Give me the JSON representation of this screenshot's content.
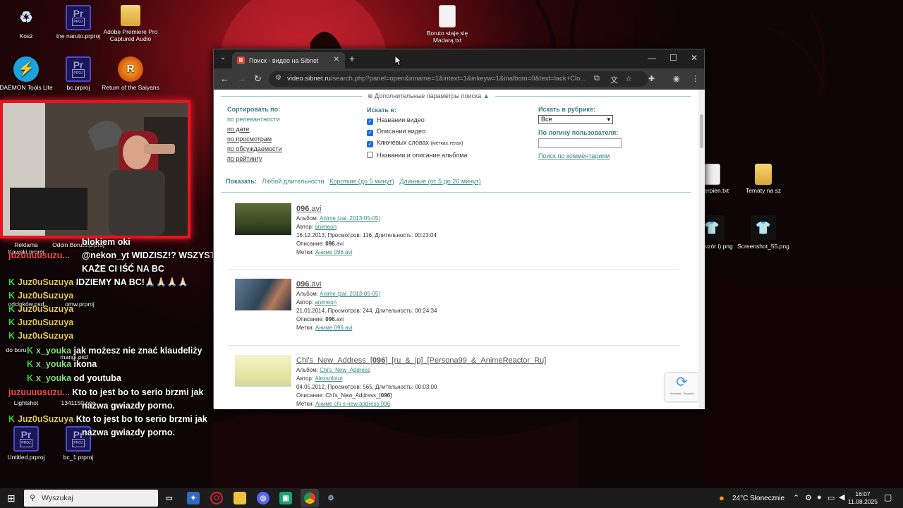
{
  "desktop": {
    "icons": [
      {
        "label": "Kosz",
        "glyph": "♻",
        "kind": "recycle"
      },
      {
        "label": "tne naruto.prproj",
        "glyph": "Pr",
        "kind": "pr"
      },
      {
        "label": "Adobe Premiere Pro Captured Audio",
        "glyph": "",
        "kind": "folder"
      },
      {
        "label": "Boruto staje się Madarą.txt",
        "glyph": "",
        "kind": "file"
      },
      {
        "label": "DAEMON Tools Lite",
        "glyph": "⚡",
        "kind": "daemon"
      },
      {
        "label": "bc.prproj",
        "glyph": "Pr",
        "kind": "pr"
      },
      {
        "label": "Return of the Saiyans",
        "glyph": "R",
        "kind": "return"
      },
      {
        "label": "Untitled.prproj",
        "glyph": "Pr",
        "kind": "pr"
      },
      {
        "label": "bc_1.prproj",
        "glyph": "Pr",
        "kind": "pr"
      },
      {
        "label": "Tematy na sz",
        "glyph": "",
        "kind": "folder"
      },
      {
        "label": "Screenshot_55.png",
        "glyph": "",
        "kind": "shirt"
      },
      {
        "label": "a sierpien.txt",
        "glyph": "",
        "kind": "file"
      },
      {
        "label": "hiko wzór i).png",
        "glyph": "",
        "kind": "shirt"
      },
      {
        "label": "Reklama Kawaki.prproj",
        "glyph": "",
        "kind": "none"
      },
      {
        "label": "Odcin Boruto.prproj",
        "glyph": "",
        "kind": "none"
      },
      {
        "label": "odcinków.psd",
        "glyph": "",
        "kind": "none"
      },
      {
        "label": "omw.prproj",
        "glyph": "",
        "kind": "none"
      },
      {
        "label": "do boru",
        "glyph": "",
        "kind": "none"
      },
      {
        "label": "mangi.psd",
        "glyph": "",
        "kind": "none"
      },
      {
        "label": "Lightshot",
        "glyph": "",
        "kind": "none"
      },
      {
        "label": "1341150.png",
        "glyph": "",
        "kind": "none"
      }
    ]
  },
  "chat": [
    {
      "user": "",
      "text": "blokiem oki",
      "badge": false
    },
    {
      "user": "",
      "text": "@nekon_yt WIDZISZ!? WSZYSTKO",
      "badge": false
    },
    {
      "user": "juzuuuusuzu...",
      "text": "",
      "badge": false
    },
    {
      "user": "",
      "text": "KAŻE CI IŚĆ NA BC",
      "badge": false
    },
    {
      "user": "Juz0uSuzuya",
      "text": "IDZIEMY NA BC!🙏🏻🙏🏻🙏🏻🙏🏻",
      "badge": true
    },
    {
      "user": "Juz0uSuzuya",
      "text": "",
      "badge": true
    },
    {
      "user": "Juz0uSuzuya",
      "text": "",
      "badge": true
    },
    {
      "user": "Juz0uSuzuya",
      "text": "",
      "badge": true
    },
    {
      "user": "Juz0uSuzuya",
      "text": "",
      "badge": true
    },
    {
      "user": "x_youka",
      "text": "jak możesz nie znać klaudeliży",
      "badge": true
    },
    {
      "user": "x_youka",
      "text": "ikona",
      "badge": true
    },
    {
      "user": "x_youka",
      "text": "od youtuba",
      "badge": true
    },
    {
      "user": "juzuuuusuzu...",
      "text": "Kto to jest bo to serio brzmi jak",
      "badge": false
    },
    {
      "user": "",
      "text": "nazwa gwiazdy porno.",
      "badge": false
    },
    {
      "user": "Juz0uSuzuya",
      "text": "Kto to jest bo to serio brzmi jak",
      "badge": true
    },
    {
      "user": "",
      "text": "nazwa gwiazdy porno.",
      "badge": false
    }
  ],
  "browser": {
    "tab_title": "Поиск - видео на Sibnet",
    "favicon": "B",
    "url_host": "video.sibnet.ru",
    "url_path": "/search.php?panel=open&inname=1&intext=1&inkeyw=1&inalbom=0&text=lack+Clo...",
    "page": {
      "advanced_toggle": "Дополнительные параметры поиска",
      "sort_header": "Сортировать по:",
      "sort_options": [
        "по релевантности",
        "по дате",
        "по просмотрам",
        "по обсуждаемости",
        "по рейтингу"
      ],
      "search_in_header": "Искать в:",
      "search_in": [
        {
          "label": "Названии видео",
          "checked": true,
          "note": ""
        },
        {
          "label": "Описании видео",
          "checked": true,
          "note": ""
        },
        {
          "label": "Ключевых словах",
          "checked": true,
          "note": "(метках,тегах)"
        },
        {
          "label": "Названии и описание альбома",
          "checked": false,
          "note": ""
        }
      ],
      "rubric_header": "Искать в рубрике:",
      "rubric_value": "Все",
      "login_header": "По логину пользователя:",
      "login_value": "",
      "comments_link": "Поиск по комментариям",
      "show_label": "Показать:",
      "show_options": [
        "Любой длительности",
        "Короткие (до 5 минут)",
        "Длинные (от 5 до 20 минут)"
      ],
      "results": [
        {
          "title_bold": "096",
          "title_rest": ".avi",
          "album_label": "Альбом:",
          "album": "Anime (zał. 2013-05-05)",
          "author_label": "Автор:",
          "author": "animeon",
          "stats": "16.12.2013, Просмотров: 116, Длительность: 00:23:04",
          "desc_label": "Описание:",
          "desc_bold": "096",
          "desc_rest": ".avi",
          "tags_label": "Метки:",
          "tags": "Аниме 096 avi"
        },
        {
          "title_bold": "096",
          "title_rest": ".avi",
          "album_label": "Альбом:",
          "album": "Anime (zał. 2013-05-05)",
          "author_label": "Автор:",
          "author": "animeon",
          "stats": "21.01.2014, Просмотров: 244, Длительность: 00:24:34",
          "desc_label": "Описание:",
          "desc_bold": "096",
          "desc_rest": ".avi",
          "tags_label": "Метки:",
          "tags": "Аниме 096 avi"
        },
        {
          "title_bold": "096",
          "title_pre": "Chi's_New_Address_[",
          "title_rest": "]_[ru_&_jp]_[Persona99_&_AnimeReactor_Ru]",
          "album_label": "Альбом:",
          "album": "Chi's_New_Address",
          "author_label": "Автор:",
          "author": "Alexsolotut",
          "stats": "04.05.2012, Просмотров: 565, Длительность: 00:03:00",
          "desc_label": "Описание:",
          "desc_pre": "Chi's_New_Address_[",
          "desc_bold": "096",
          "desc_rest": "]",
          "tags_label": "Метки:",
          "tags": "Аниме chi s new address 096"
        }
      ],
      "recaptcha": "Условия · Защита"
    }
  },
  "taskbar": {
    "search_placeholder": "Wyszukaj",
    "weather": "24°C  Słonecznie",
    "time": "16:07",
    "date": "11.08.2025"
  }
}
